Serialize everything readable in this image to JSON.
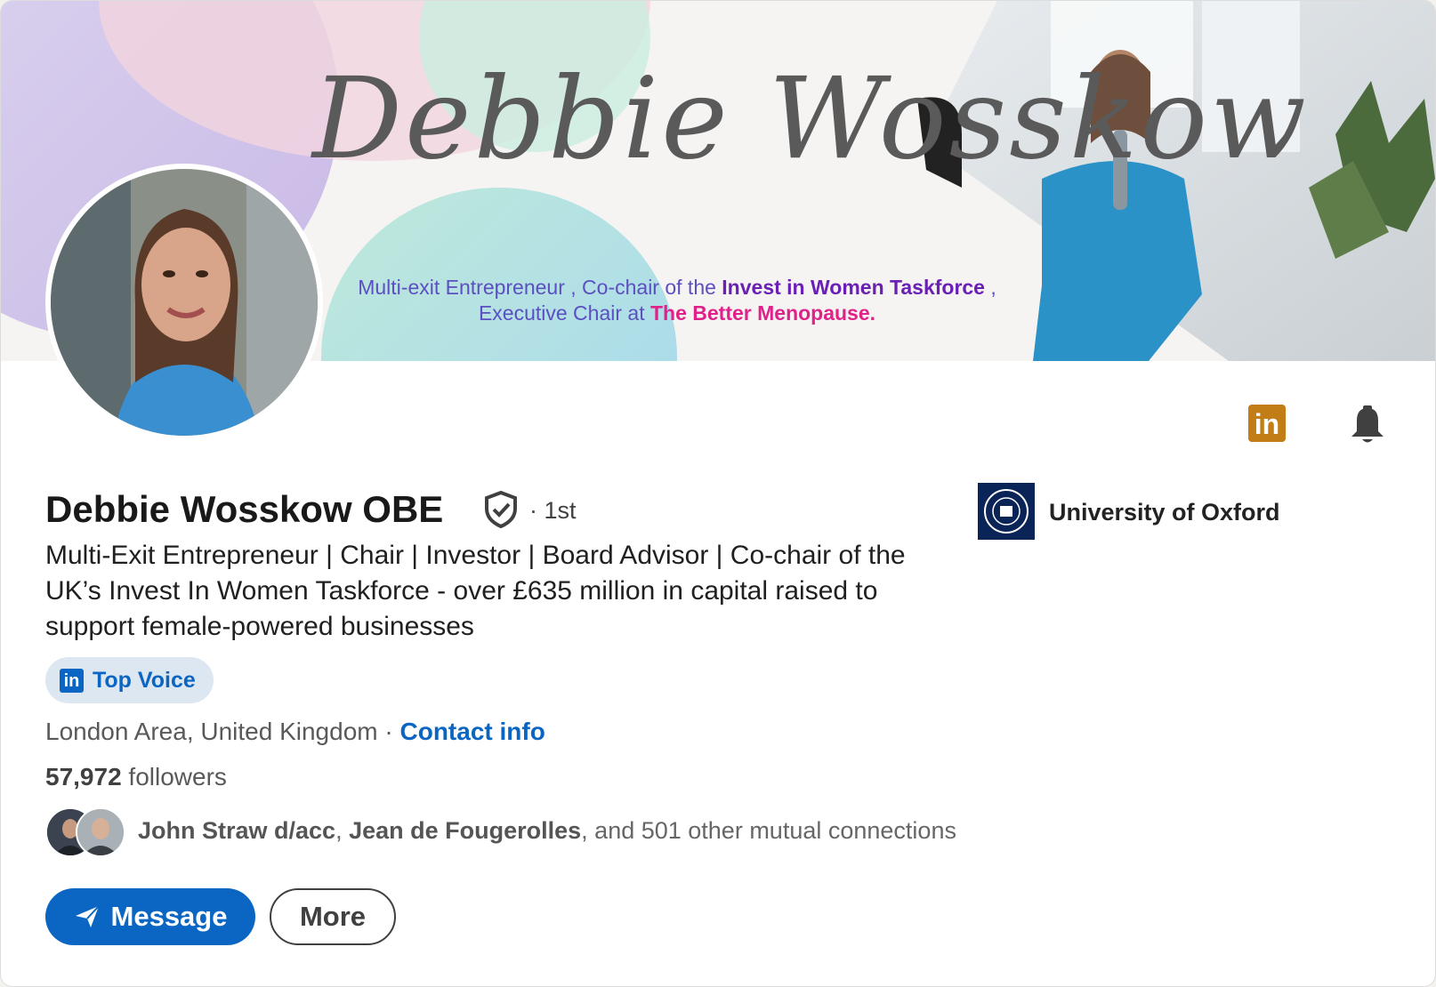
{
  "banner": {
    "name_script": "Debbie Wosskow",
    "tagline_line1_a": "Multi-exit Entrepreneur , Co-chair of the ",
    "tagline_line1_b": "Invest in Women Taskforce",
    "tagline_line1_c": " ,",
    "tagline_line2_a": "Executive Chair at ",
    "tagline_line2_b": "The Better Menopause."
  },
  "profile": {
    "name": "Debbie Wosskow OBE",
    "degree": "· 1st",
    "headline": "Multi-Exit Entrepreneur | Chair | Investor | Board Advisor | Co-chair of the UK’s Invest In Women Taskforce - over £635 million in capital raised to support female-powered businesses",
    "badge_label": "Top Voice",
    "location": "London Area, United Kingdom",
    "location_sep": " · ",
    "contact_label": "Contact info",
    "followers_count": "57,972",
    "followers_label": " followers",
    "mutual_1": "John Straw d/acc",
    "mutual_sep": ", ",
    "mutual_2": "Jean de Fougerolles",
    "mutual_rest": ", and 501 other mutual connections"
  },
  "education": {
    "school": "University of Oxford"
  },
  "actions": {
    "message_label": "Message",
    "more_label": "More"
  },
  "icons": {
    "linkedin": "linkedin-icon",
    "bell": "bell-icon",
    "verified": "verified-shield-icon",
    "send": "send-icon"
  },
  "colors": {
    "primary_blue": "#0a66c2",
    "linkedin_gold": "#c37d16",
    "badge_bg": "#dde7f1",
    "oxford_navy": "#0b2457"
  }
}
